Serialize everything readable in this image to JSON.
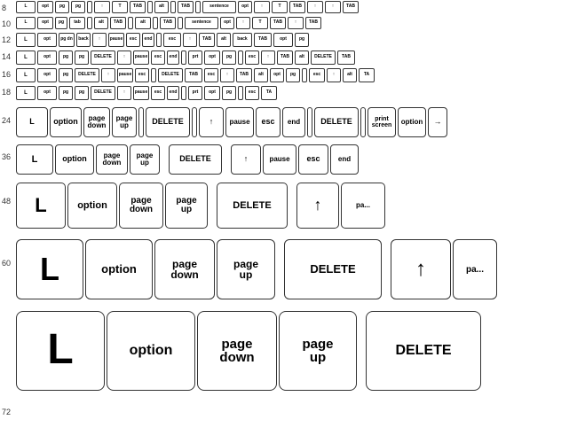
{
  "rows": {
    "row8": {
      "label": "8"
    },
    "row10": {
      "label": "10"
    },
    "row12": {
      "label": "12"
    },
    "row14": {
      "label": "14"
    },
    "row16": {
      "label": "16"
    },
    "row18": {
      "label": "18"
    },
    "row24": {
      "label": "24"
    },
    "row36": {
      "label": "36"
    },
    "row48": {
      "label": "48"
    },
    "row60": {
      "label": "60"
    },
    "row72": {
      "label": "72"
    }
  },
  "keys": {
    "L": "L",
    "option": "option",
    "page_down": "page\ndown",
    "page_up": "page\nup",
    "delete": "DELETE",
    "arrow_up": "↑",
    "pause": "pause",
    "esc": "esc",
    "end": "end",
    "print_screen": "print\nscreen",
    "arrow_right": "→",
    "tab": "TAB",
    "alt": "alt",
    "sentence": "sentence"
  }
}
